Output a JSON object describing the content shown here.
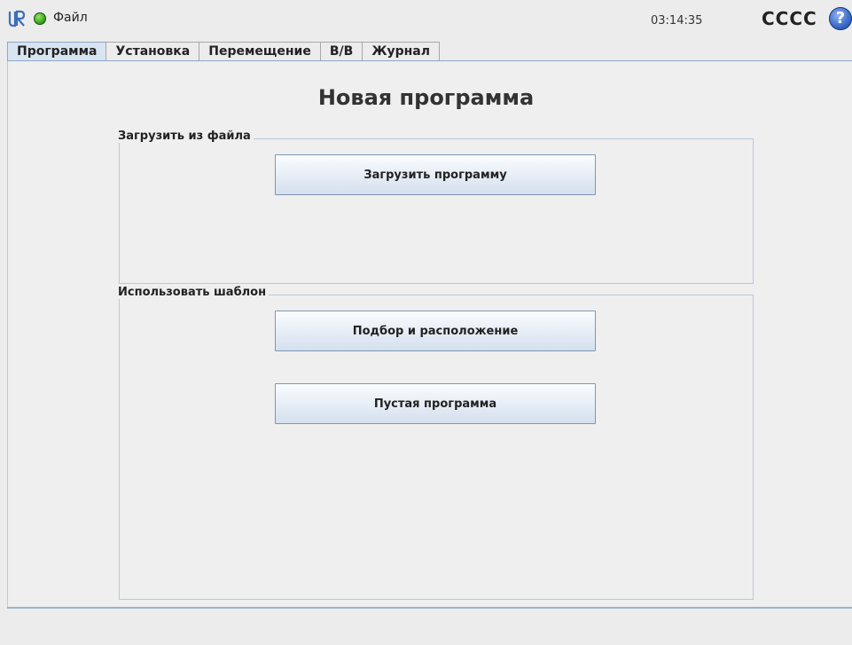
{
  "topbar": {
    "file_menu": "Файл",
    "clock": "03:14:35",
    "robot_name": "CCCC",
    "help": "?"
  },
  "tabs": [
    {
      "label": "Программа",
      "active": true
    },
    {
      "label": "Установка"
    },
    {
      "label": "Перемещение"
    },
    {
      "label": "В/В"
    },
    {
      "label": "Журнал"
    }
  ],
  "main": {
    "title": "Новая программа",
    "load_group": {
      "label": "Загрузить из файла",
      "load_button": "Загрузить программу"
    },
    "template_group": {
      "label": "Использовать шаблон",
      "pick_place_button": "Подбор и расположение",
      "empty_button": "Пустая программа"
    }
  },
  "colors": {
    "accent": "#8fa7c6",
    "status_ok": "#38a81e",
    "help": "#3566c7"
  }
}
